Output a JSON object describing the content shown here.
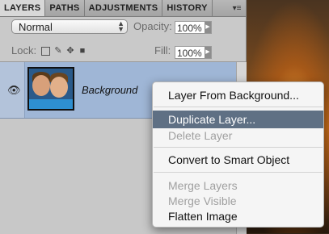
{
  "tabs": [
    {
      "label": "LAYERS",
      "active": true
    },
    {
      "label": "PATHS",
      "active": false
    },
    {
      "label": "ADJUSTMENTS",
      "active": false
    },
    {
      "label": "HISTORY",
      "active": false
    }
  ],
  "blend_mode": "Normal",
  "opacity": {
    "label": "Opacity:",
    "value": "100%"
  },
  "lock": {
    "label": "Lock:"
  },
  "fill": {
    "label": "Fill:",
    "value": "100%"
  },
  "layer": {
    "name": "Background",
    "visible": true
  },
  "menu": {
    "items": [
      {
        "label": "Layer From Background...",
        "enabled": true,
        "highlighted": false
      },
      {
        "label": "Duplicate Layer...",
        "enabled": true,
        "highlighted": true
      },
      {
        "label": "Delete Layer",
        "enabled": false,
        "highlighted": false
      },
      {
        "label": "Convert to Smart Object",
        "enabled": true,
        "highlighted": false
      },
      {
        "label": "Merge Layers",
        "enabled": false,
        "highlighted": false
      },
      {
        "label": "Merge Visible",
        "enabled": false,
        "highlighted": false
      },
      {
        "label": "Flatten Image",
        "enabled": true,
        "highlighted": false
      }
    ]
  },
  "colors": {
    "highlight": "#5f7084",
    "layer_selected": "#9fb6d6"
  }
}
